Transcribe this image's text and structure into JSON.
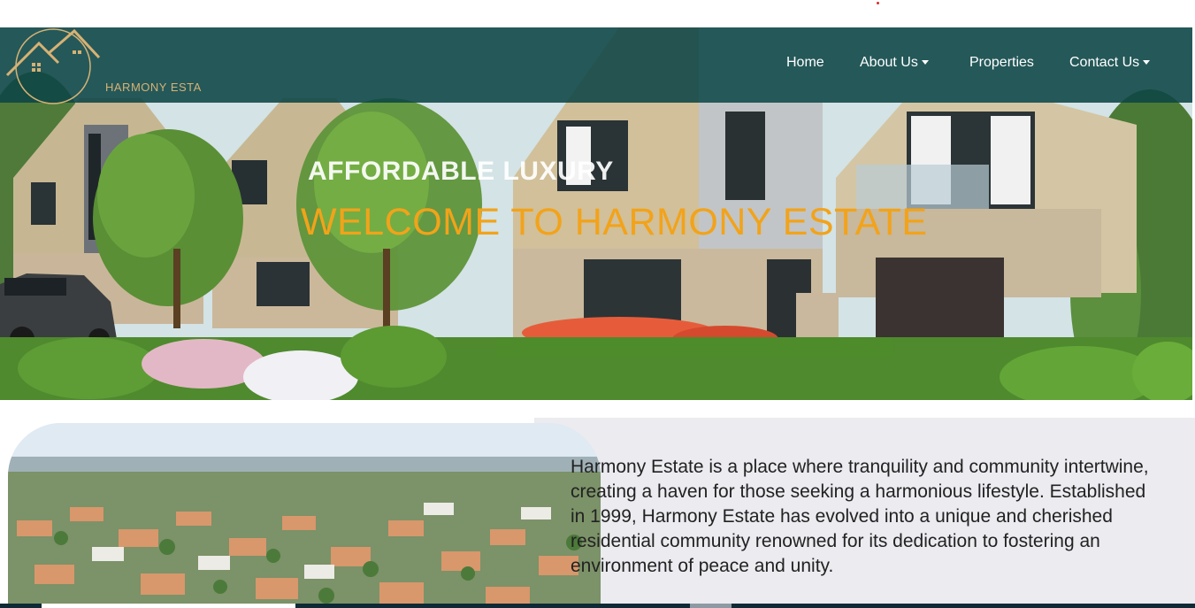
{
  "brand": {
    "logo_text": "HARMONY ESTA",
    "colors": {
      "navbar": "#0c4446",
      "accent_gold": "#d6b274",
      "headline_orange": "#f2a31a"
    }
  },
  "nav": {
    "home": "Home",
    "about": "About Us",
    "properties": "Properties",
    "contact": "Contact Us",
    "dropdown_icon": "caret-down-icon"
  },
  "hero": {
    "tagline": "AFFORDABLE LUXURY",
    "headline": "WELCOME TO HARMONY ESTATE"
  },
  "about": {
    "paragraph": "Harmony Estate is a place where tranquility and community intertwine, creating a haven for those seeking a harmonious lifestyle. Established in 1999, Harmony Estate has evolved into a unique and cherished residential community renowned for its dedication to fostering an environment of peace and unity."
  }
}
